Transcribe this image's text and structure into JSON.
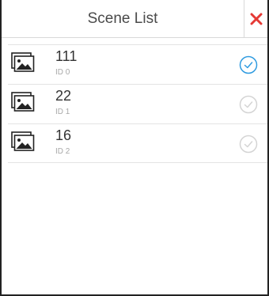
{
  "header": {
    "title": "Scene List"
  },
  "colors": {
    "close": "#e53935",
    "selected": "#2f9be0",
    "unselected": "#d4d4d4"
  },
  "scenes": [
    {
      "name": "111",
      "id_label": "ID 0",
      "selected": true
    },
    {
      "name": "22",
      "id_label": "ID 1",
      "selected": false
    },
    {
      "name": "16",
      "id_label": "ID 2",
      "selected": false
    }
  ]
}
